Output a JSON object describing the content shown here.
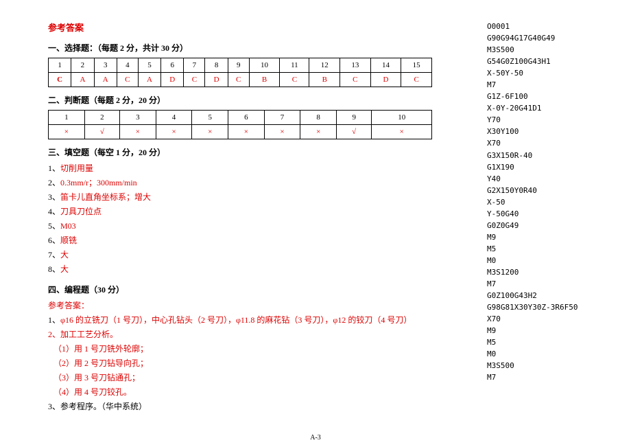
{
  "title": "参考答案",
  "section1": {
    "heading": "一、选择题：（每题 2 分，共计 30 分）",
    "nums": [
      "1",
      "2",
      "3",
      "4",
      "5",
      "6",
      "7",
      "8",
      "9",
      "10",
      "11",
      "12",
      "13",
      "14",
      "15"
    ],
    "answers": [
      "C",
      "A",
      "A",
      "C",
      "A",
      "D",
      "C",
      "D",
      "C",
      "B",
      "C",
      "B",
      "C",
      "D",
      "C"
    ]
  },
  "section2": {
    "heading": "二、判断题（每题 2 分，20 分）",
    "nums": [
      "1",
      "2",
      "3",
      "4",
      "5",
      "6",
      "7",
      "8",
      "9",
      "10"
    ],
    "answers": [
      "×",
      "√",
      "×",
      "×",
      "×",
      "×",
      "×",
      "×",
      "√",
      "×"
    ]
  },
  "section3": {
    "heading": "三、填空题（每空 1 分，20 分）",
    "items": [
      {
        "n": "1、",
        "a": "切削用量"
      },
      {
        "n": "2、",
        "a": "0.3mm/r；300mm/min"
      },
      {
        "n": "3、",
        "a": "笛卡儿直角坐标系；增大"
      },
      {
        "n": "4、",
        "a": "刀具刀位点"
      },
      {
        "n": "5、",
        "a": "M03"
      },
      {
        "n": "6、",
        "a": "顺铣"
      },
      {
        "n": "7、",
        "a": "大"
      },
      {
        "n": "8、",
        "a": "大"
      }
    ]
  },
  "section4": {
    "heading": "四、编程题（30 分）",
    "ref": "参考答案：",
    "line1_pre": "1、",
    "line1": "φ16 的立铣刀（1 号刀），中心孔钻头（2 号刀），φ11.8 的麻花钻（3 号刀），φ12 的铰刀（4 号刀）",
    "line2": "2、加工工艺分析。",
    "steps": [
      "（1）用 1 号刀铣外轮廓；",
      "（2）用 2 号刀钻导向孔；",
      "（3）用 3 号刀钻通孔；",
      "（4）用 4 号刀铰孔。"
    ],
    "line3": "3、参考程序。（华中系统）"
  },
  "code": [
    "O0001",
    "G90G94G17G40G49",
    "M3S500",
    "G54G0Z100G43H1",
    "X-50Y-50",
    "M7",
    "G1Z-6F100",
    "X-0Y-20G41D1",
    "Y70",
    "X30Y100",
    "X70",
    "G3X150R-40",
    "G1X190",
    "Y40",
    "G2X150Y0R40",
    "X-50",
    "Y-50G40",
    "G0Z0G49",
    "M9",
    "M5",
    "M0",
    "M3S1200",
    "M7",
    "G0Z100G43H2",
    "G98G81X30Y30Z-3R6F50",
    "X70",
    "M9",
    "M5",
    "M0",
    "M3S500",
    "M7"
  ],
  "pagenum": "A-3"
}
